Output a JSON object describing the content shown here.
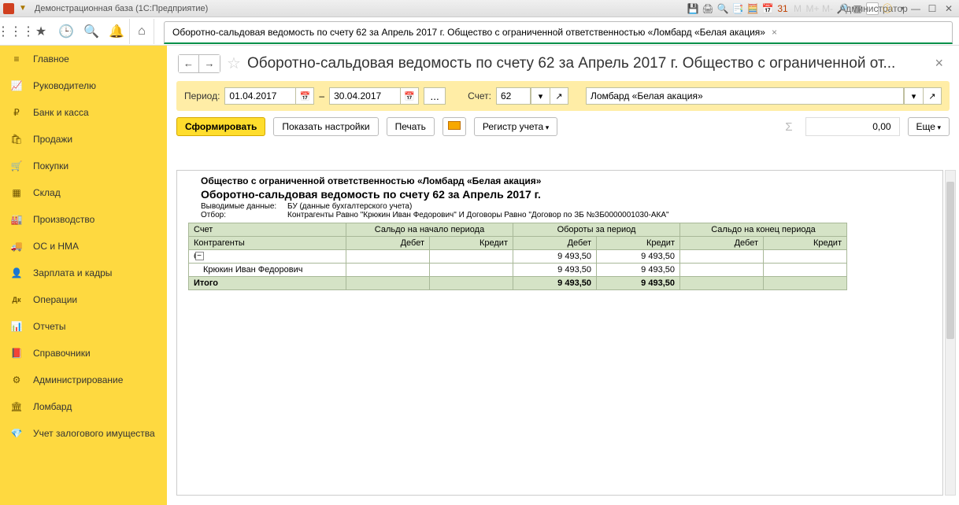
{
  "titlebar": {
    "text": "Демонстрационная база  (1С:Предприятие)",
    "admin": "Администратор"
  },
  "tab": {
    "title": "Оборотно-сальдовая ведомость по счету 62 за Апрель 2017 г. Общество с ограниченной ответственностью «Ломбард «Белая акация»"
  },
  "doc": {
    "title": "Оборотно-сальдовая ведомость по счету 62 за Апрель 2017 г. Общество с ограниченной от..."
  },
  "sidebar": {
    "items": [
      {
        "label": "Главное",
        "icon": "≡"
      },
      {
        "label": "Руководителю",
        "icon": "📈"
      },
      {
        "label": "Банк и касса",
        "icon": "₽"
      },
      {
        "label": "Продажи",
        "icon": "🛍"
      },
      {
        "label": "Покупки",
        "icon": "🛒"
      },
      {
        "label": "Склад",
        "icon": "▦"
      },
      {
        "label": "Производство",
        "icon": "🏭"
      },
      {
        "label": "ОС и НМА",
        "icon": "🚚"
      },
      {
        "label": "Зарплата и кадры",
        "icon": "👤"
      },
      {
        "label": "Операции",
        "icon": "Дк"
      },
      {
        "label": "Отчеты",
        "icon": "📊"
      },
      {
        "label": "Справочники",
        "icon": "📕"
      },
      {
        "label": "Администрирование",
        "icon": "⚙"
      },
      {
        "label": "Ломбард",
        "icon": "🏛"
      },
      {
        "label": "Учет залогового имущества",
        "icon": "💎"
      }
    ]
  },
  "params": {
    "period_label": "Период:",
    "date_from": "01.04.2017",
    "date_to": "30.04.2017",
    "dash": "–",
    "account_label": "Счет:",
    "account": "62",
    "company": "Ломбард «Белая акация»"
  },
  "actions": {
    "form": "Сформировать",
    "settings": "Показать настройки",
    "print": "Печать",
    "register": "Регистр учета",
    "sum_value": "0,00",
    "more": "Еще"
  },
  "report": {
    "org": "Общество с ограниченной ответственностью «Ломбард «Белая акация»",
    "title": "Оборотно-сальдовая ведомость по счету 62 за Апрель 2017 г.",
    "output_label": "Выводимые данные:",
    "output_value": "БУ (данные бухгалтерского учета)",
    "filter_label": "Отбор:",
    "filter_value": "Контрагенты Равно \"Крюкин Иван Федорович\" И Договоры Равно \"Договор по ЗБ №ЗБ0000001030-АКА\"",
    "headers": {
      "account": "Счет",
      "counterparties": "Контрагенты",
      "start_balance": "Сальдо на начало периода",
      "turnover": "Обороты за период",
      "end_balance": "Сальдо на конец периода",
      "debit": "Дебет",
      "credit": "Кредит"
    },
    "rows": {
      "acct": {
        "label": "62",
        "turnover_d": "9 493,50",
        "turnover_c": "9 493,50"
      },
      "child": {
        "label": "Крюкин Иван Федорович",
        "turnover_d": "9 493,50",
        "turnover_c": "9 493,50"
      },
      "total": {
        "label": "Итого",
        "turnover_d": "9 493,50",
        "turnover_c": "9 493,50"
      }
    }
  }
}
